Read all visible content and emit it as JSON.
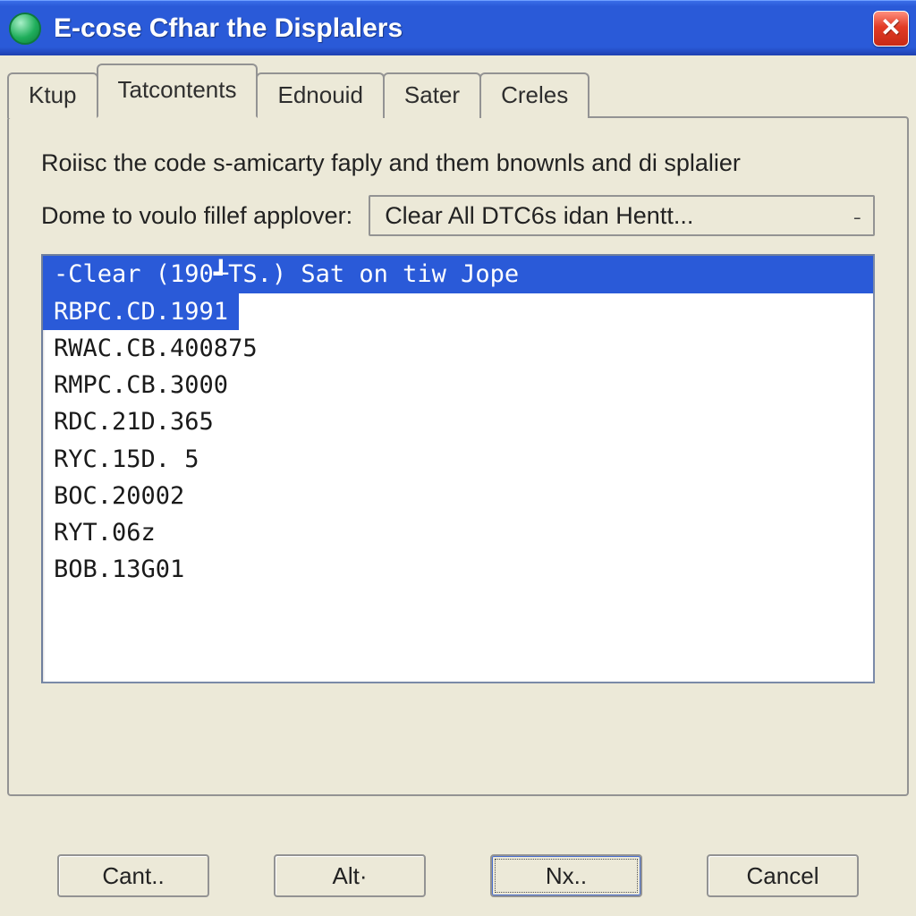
{
  "window": {
    "title": "E-cose Cfhar the Displalers"
  },
  "tabs": [
    {
      "label": "Ktup"
    },
    {
      "label": "Tatcontents"
    },
    {
      "label": "Ednouid"
    },
    {
      "label": "Sater"
    },
    {
      "label": "Creles"
    }
  ],
  "active_tab_index": 1,
  "panel": {
    "description": "Roiisc the code s-amicarty faply and them bnownls and di splalier",
    "combo_label": "Dome to voulo fillef applover:",
    "combo_value": "Clear All DTC6s idan Hentt...",
    "combo_arrow": "˗"
  },
  "list": {
    "items": [
      "-Clear (190┹TS.) Sat on tiw Jope",
      "RBPC.CD.1991",
      "RWAC.CB.400875",
      "RMPC.CB.3000",
      "RDC.21D.365",
      "RYC.15D. 5",
      "BOC.20002",
      "RYT.06z",
      "BOB.13G01"
    ],
    "selected_indices": [
      0,
      1
    ]
  },
  "buttons": {
    "cant": "Cant..",
    "alt": "Alt·",
    "nx": "Nx..",
    "cancel": "Cancel"
  }
}
